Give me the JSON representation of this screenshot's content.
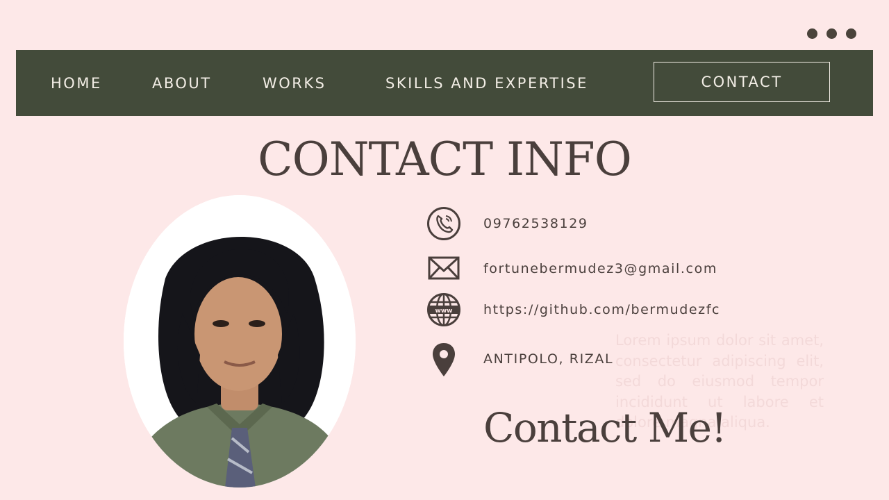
{
  "nav": {
    "home": "HOME",
    "about": "ABOUT",
    "works": "WORKS",
    "skills": "SKILLS AND EXPERTISE",
    "contact": "CONTACT"
  },
  "page": {
    "title": "CONTACT INFO",
    "cta": "Contact Me!"
  },
  "contacts": [
    {
      "icon": "phone-icon",
      "text": "09762538129"
    },
    {
      "icon": "mail-icon",
      "text": "fortunebermudez3@gmail.com"
    },
    {
      "icon": "globe-www-icon",
      "text": "https://github.com/bermudezfc"
    },
    {
      "icon": "location-pin-icon",
      "text": "ANTIPOLO, RIZAL"
    }
  ],
  "faded_text": "Lorem ipsum dolor sit amet, consectetur adipiscing elit, sed do eiusmod tempor incididunt ut labore et dolore magna aliqua.",
  "colors": {
    "background": "#fde8e8",
    "navbar": "#434b3a",
    "nav_text": "#f3eee6",
    "heading_text": "#4a3f3c"
  }
}
